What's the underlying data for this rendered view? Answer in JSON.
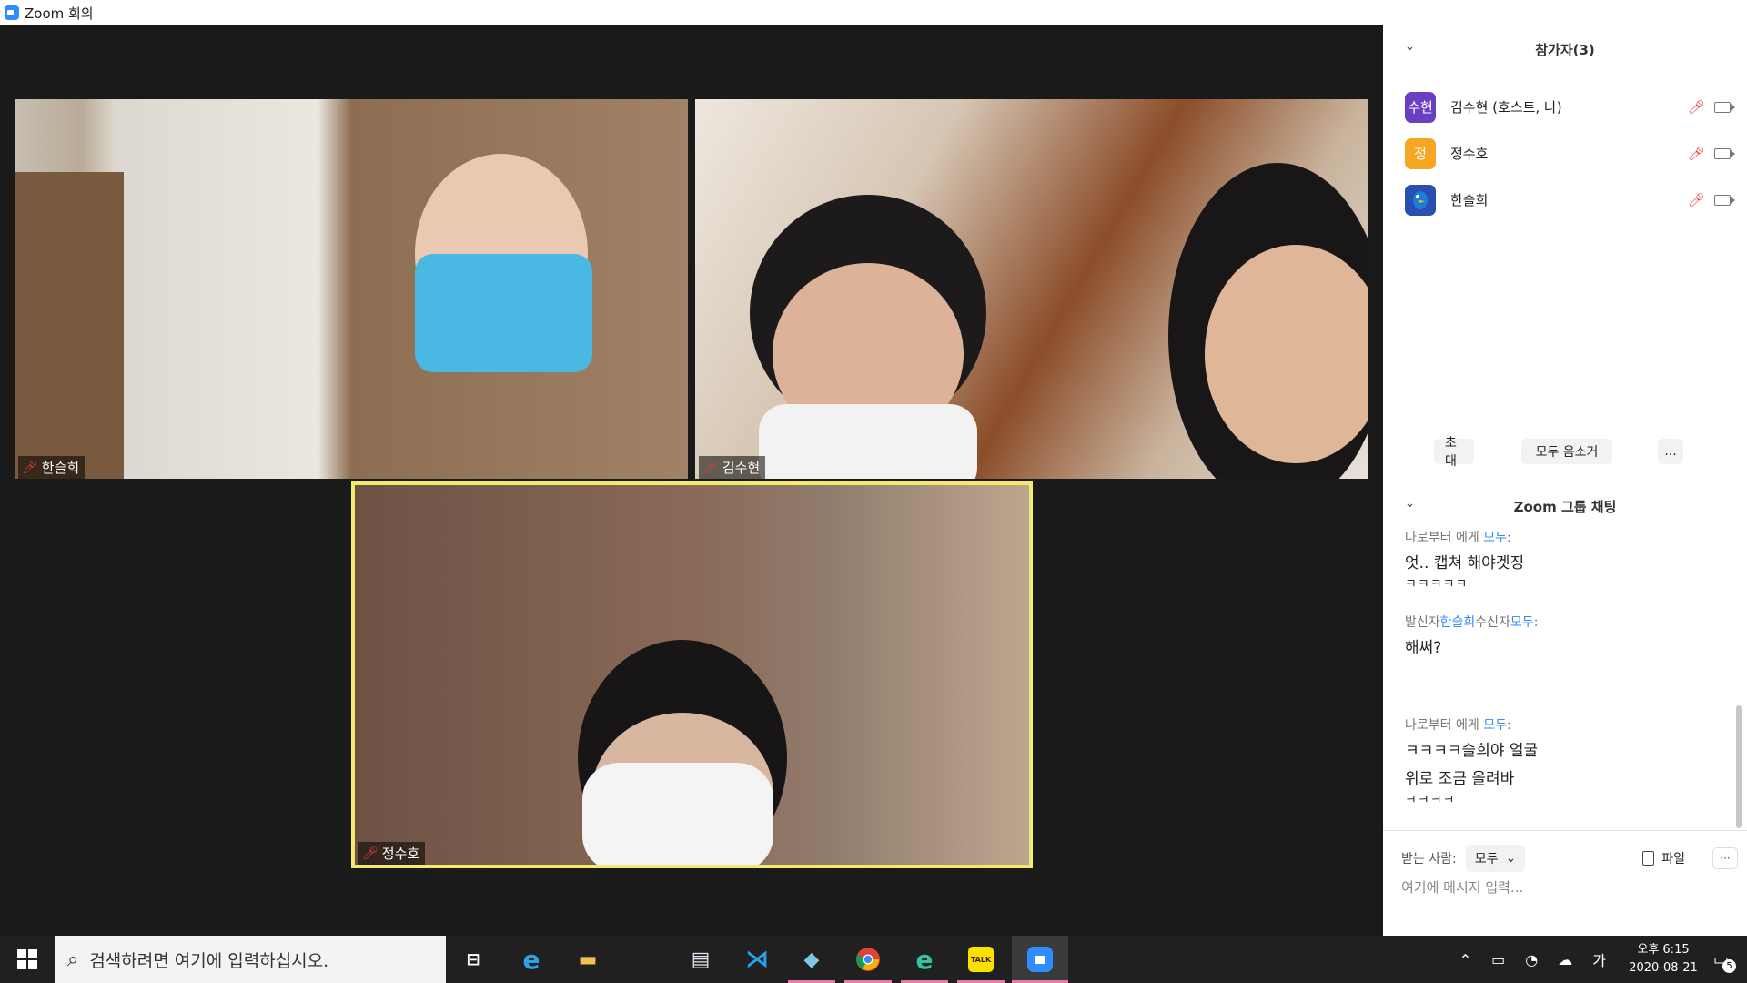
{
  "window": {
    "title": "Zoom 회의",
    "minimize": "—",
    "restore": "❐",
    "close": "✕"
  },
  "videos": [
    {
      "name": "한슬희",
      "muted": true
    },
    {
      "name": "김수현",
      "muted": true
    },
    {
      "name": "정수호",
      "muted": true,
      "active_speaker": true
    }
  ],
  "participants": {
    "header": "참가자(3)",
    "items": [
      {
        "avatar": "수현",
        "avatar_color": "#6a3fc2",
        "name": "김수현 (호스트, 나)"
      },
      {
        "avatar": "정",
        "avatar_color": "#f5a623",
        "name": "정수호"
      },
      {
        "avatar": "",
        "avatar_color": "#2a4fb0",
        "name": "한슬희"
      }
    ],
    "buttons": {
      "invite": "초대",
      "mute_all": "모두 음소거",
      "more": "..."
    }
  },
  "chat": {
    "header": "Zoom 그룹 채팅",
    "messages": [
      {
        "meta_prefix": "나로부터 에게 ",
        "meta_to": "모두",
        "meta_suffix": ":",
        "lines": [
          "엇.. 캡쳐 해야겟징"
        ],
        "tail": "ㅋㅋㅋㅋㅋ"
      },
      {
        "meta_from_label": "발신자",
        "meta_from": "한슬희",
        "meta_to_label": "수신자",
        "meta_to": "모두",
        "meta_suffix": ":",
        "lines": [
          "해써?"
        ]
      },
      {
        "meta_prefix": "나로부터 에게 ",
        "meta_to": "모두",
        "meta_suffix": ":",
        "lines": [
          "ㅋㅋㅋㅋ슬희야 얼굴",
          "위로 조금 올려바"
        ],
        "tail": "ㅋㅋㅋㅋ"
      }
    ],
    "recipient_label": "받는 사람:",
    "recipient_value": "모두",
    "file_label": "파일",
    "more": "···",
    "input_placeholder": "여기에 메시지 입력..."
  },
  "taskbar": {
    "search_placeholder": "검색하려면 여기에 입력하십시오.",
    "ime": "가",
    "clock_time": "오후 6:15",
    "clock_date": "2020-08-21",
    "notifications": "5"
  }
}
